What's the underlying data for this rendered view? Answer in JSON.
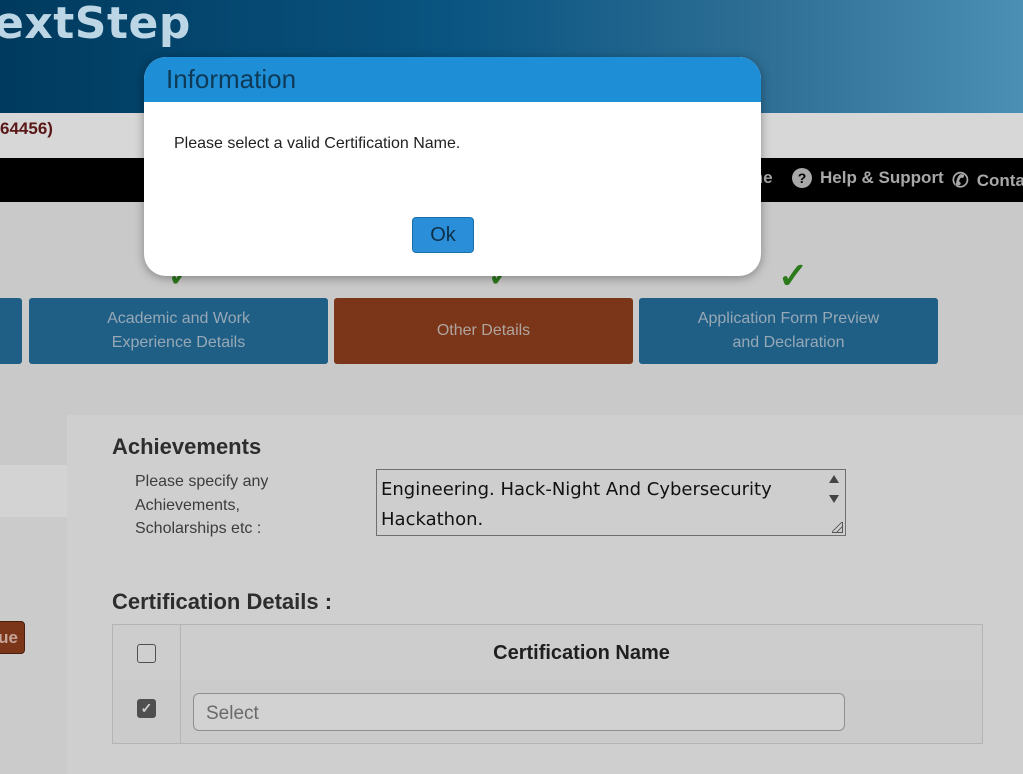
{
  "header": {
    "brand": "extStep"
  },
  "registration": {
    "text": "64456)"
  },
  "nav": {
    "items": [
      {
        "label": "me"
      },
      {
        "label": "Help & Support",
        "icon": "question-circle-icon"
      },
      {
        "label": "Conta",
        "icon": "phone-icon"
      }
    ]
  },
  "stepper": {
    "steps": [
      {
        "label_1": "Academic and Work",
        "label_2": "Experience Details",
        "status": "complete"
      },
      {
        "label_1": "Other Details",
        "label_2": "",
        "status": "active"
      },
      {
        "label_1": "Application Form Preview",
        "label_2": "and Declaration",
        "status": "complete"
      }
    ],
    "check_glyph": "✓"
  },
  "left_button": {
    "label": "ue"
  },
  "achievements": {
    "heading": "Achievements",
    "label": "Please specify any Achievements, Scholarships etc :",
    "value": "Engineering. Hack-Night And Cybersecurity Hackathon."
  },
  "certification": {
    "heading": "Certification Details :",
    "column_header": "Certification Name",
    "rows": [
      {
        "checked": true,
        "select_value": "Select"
      }
    ],
    "header_checked": false
  },
  "dialog": {
    "title": "Information",
    "message": "Please select a valid Certification Name.",
    "ok_label": "Ok"
  },
  "colors": {
    "dialog_title_bg": "#1e8fd6",
    "active_step": "#7b3619",
    "step_blue": "#1f5f86",
    "check_green": "#2d7a1d"
  }
}
